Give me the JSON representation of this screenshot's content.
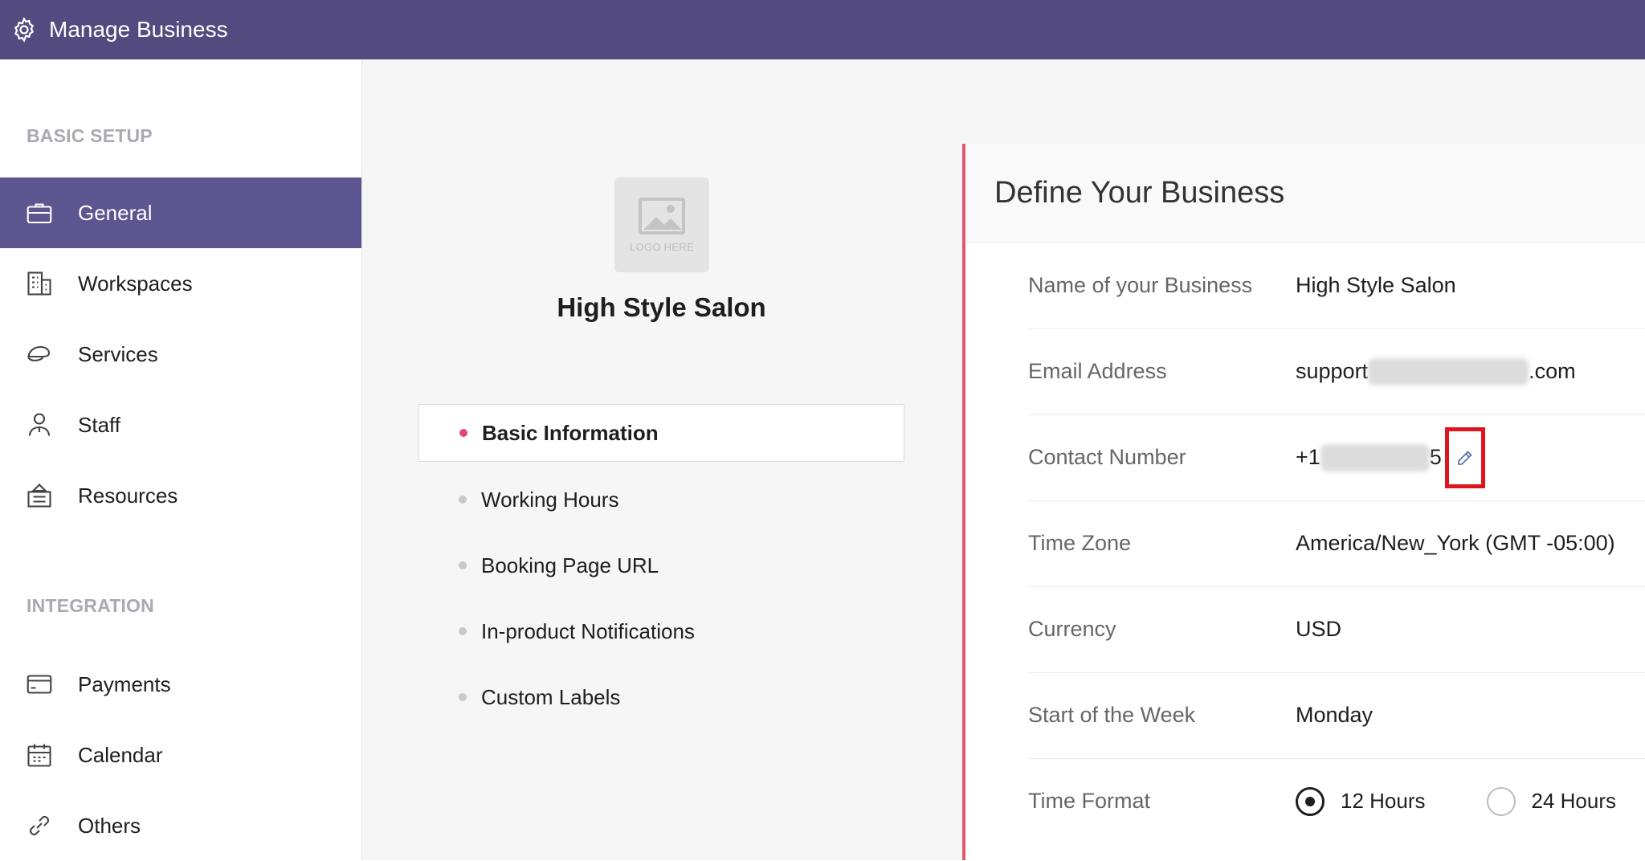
{
  "header": {
    "title": "Manage Business",
    "icon": "gear-icon"
  },
  "sidebar": {
    "sections": [
      {
        "label": "BASIC SETUP",
        "items": [
          {
            "label": "General",
            "icon": "briefcase-icon",
            "active": true
          },
          {
            "label": "Workspaces",
            "icon": "building-icon"
          },
          {
            "label": "Services",
            "icon": "cap-icon"
          },
          {
            "label": "Staff",
            "icon": "staff-icon"
          },
          {
            "label": "Resources",
            "icon": "resources-icon"
          }
        ]
      },
      {
        "label": "INTEGRATION",
        "items": [
          {
            "label": "Payments",
            "icon": "card-icon"
          },
          {
            "label": "Calendar",
            "icon": "calendar-icon"
          },
          {
            "label": "Others",
            "icon": "link-icon"
          }
        ]
      }
    ]
  },
  "business": {
    "logo_placeholder": "LOGO HERE",
    "name": "High Style Salon"
  },
  "subnav": {
    "items": [
      {
        "label": "Basic Information",
        "active": true
      },
      {
        "label": "Working Hours"
      },
      {
        "label": "Booking Page URL"
      },
      {
        "label": "In-product Notifications"
      },
      {
        "label": "Custom Labels"
      }
    ]
  },
  "form": {
    "title": "Define Your Business",
    "fields": {
      "name": {
        "label": "Name of your Business",
        "value": "High Style Salon"
      },
      "email": {
        "label": "Email Address",
        "value_start": "support",
        "value_end": ".com"
      },
      "contact": {
        "label": "Contact Number",
        "value_start": "+1",
        "value_end": "5"
      },
      "timezone": {
        "label": "Time Zone",
        "value": "America/New_York (GMT -05:00)"
      },
      "currency": {
        "label": "Currency",
        "value": "USD"
      },
      "week_start": {
        "label": "Start of the Week",
        "value": "Monday"
      },
      "time_format": {
        "label": "Time Format",
        "options": [
          {
            "label": "12 Hours",
            "selected": true
          },
          {
            "label": "24 Hours",
            "selected": false
          }
        ]
      }
    }
  },
  "colors": {
    "header": "#534b7f",
    "active_nav": "#5d5590",
    "accent_dot": "#e0457b",
    "highlight": "#e0141e"
  }
}
